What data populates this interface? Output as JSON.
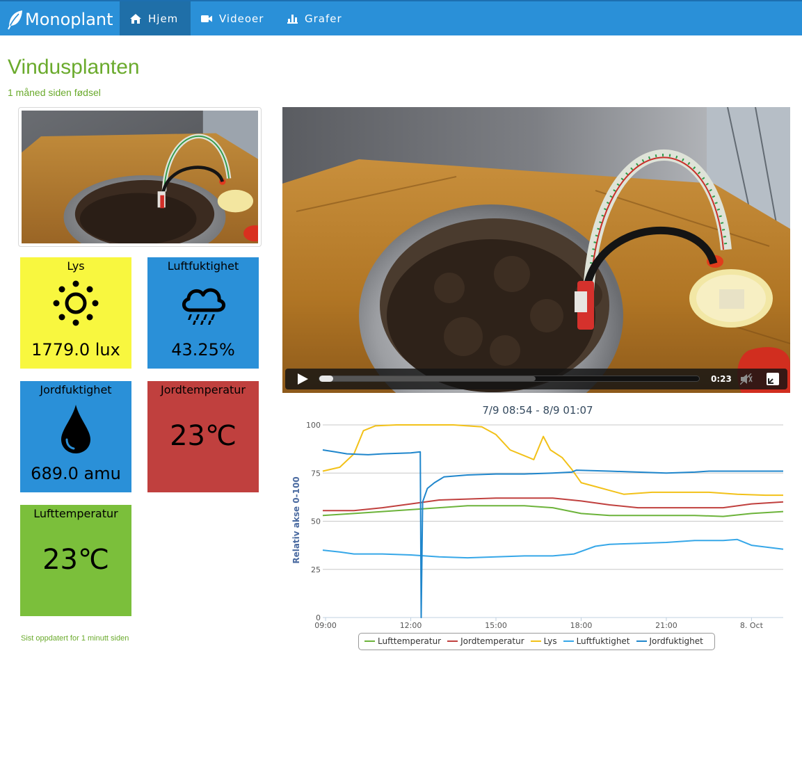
{
  "brand": {
    "name": "Monoplant"
  },
  "nav": {
    "items": [
      {
        "label": "Hjem",
        "icon": "home-icon",
        "active": true
      },
      {
        "label": "Videoer",
        "icon": "video-camera-icon",
        "active": false
      },
      {
        "label": "Grafer",
        "icon": "bar-chart-icon",
        "active": false
      }
    ]
  },
  "plant": {
    "name": "Vindusplanten",
    "age": "1 måned siden fødsel"
  },
  "sensors": {
    "lys": {
      "label": "Lys",
      "value": "1779.0 lux",
      "icon": "sun-icon",
      "color": "#f8f73f"
    },
    "luftfuktighet": {
      "label": "Luftfuktighet",
      "value": "43.25%",
      "icon": "rain-cloud-icon",
      "color": "#2a90d8"
    },
    "jordfuktighet": {
      "label": "Jordfuktighet",
      "value": "689.0 amu",
      "icon": "water-drop-icon",
      "color": "#2a90d8"
    },
    "jordtemperatur": {
      "label": "Jordtemperatur",
      "value": "23℃",
      "color": "#c0403e"
    },
    "lufttemperatur": {
      "label": "Lufttemperatur",
      "value": "23℃",
      "color": "#7bbf3b"
    }
  },
  "updated": "Sist oppdatert for 1 minutt siden",
  "video": {
    "time": "0:23",
    "progress": 0.0,
    "buffered": 0.57
  },
  "chart_data": {
    "type": "line",
    "title": "7/9 08:54 - 8/9 01:07",
    "ylabel": "Relativ akse 0-100",
    "ylim": [
      0,
      100
    ],
    "yticks": [
      0,
      25,
      50,
      75,
      100
    ],
    "xlim": [
      "08:54",
      "01:07"
    ],
    "xticks": [
      "09:00",
      "12:00",
      "15:00",
      "18:00",
      "21:00",
      "8. Oct"
    ],
    "grid": true,
    "legend": "bottom",
    "series": [
      {
        "name": "Lufttemperatur",
        "color": "#6cb33a",
        "points": [
          [
            "08:54",
            53
          ],
          [
            "10:00",
            54
          ],
          [
            "11:00",
            55
          ],
          [
            "12:00",
            56
          ],
          [
            "13:00",
            57
          ],
          [
            "14:00",
            58
          ],
          [
            "15:00",
            58
          ],
          [
            "16:00",
            58
          ],
          [
            "17:00",
            57
          ],
          [
            "18:00",
            54
          ],
          [
            "19:00",
            53
          ],
          [
            "20:00",
            53
          ],
          [
            "21:00",
            53
          ],
          [
            "22:00",
            53
          ],
          [
            "23:00",
            52.5
          ],
          [
            "00:00",
            54
          ],
          [
            "01:07",
            55
          ]
        ]
      },
      {
        "name": "Jordtemperatur",
        "color": "#c0403e",
        "points": [
          [
            "08:54",
            55.5
          ],
          [
            "10:00",
            55.5
          ],
          [
            "11:00",
            57
          ],
          [
            "12:00",
            59
          ],
          [
            "13:00",
            61
          ],
          [
            "14:00",
            61.5
          ],
          [
            "15:00",
            62
          ],
          [
            "16:00",
            62
          ],
          [
            "17:00",
            62
          ],
          [
            "18:00",
            60.5
          ],
          [
            "19:00",
            58.5
          ],
          [
            "20:00",
            57
          ],
          [
            "21:00",
            57
          ],
          [
            "22:00",
            57
          ],
          [
            "23:00",
            57
          ],
          [
            "00:00",
            59
          ],
          [
            "01:07",
            60
          ]
        ]
      },
      {
        "name": "Lys",
        "color": "#f2c118",
        "points": [
          [
            "08:54",
            76
          ],
          [
            "09:30",
            78
          ],
          [
            "10:00",
            85
          ],
          [
            "10:20",
            97
          ],
          [
            "10:45",
            99.5
          ],
          [
            "11:30",
            100
          ],
          [
            "12:30",
            100
          ],
          [
            "13:30",
            100
          ],
          [
            "14:30",
            99
          ],
          [
            "15:00",
            95
          ],
          [
            "15:30",
            87
          ],
          [
            "16:00",
            84
          ],
          [
            "16:20",
            82
          ],
          [
            "16:40",
            94
          ],
          [
            "16:55",
            87
          ],
          [
            "17:20",
            83
          ],
          [
            "17:40",
            77
          ],
          [
            "18:00",
            70
          ],
          [
            "18:30",
            68
          ],
          [
            "19:00",
            66
          ],
          [
            "19:30",
            64
          ],
          [
            "20:30",
            65
          ],
          [
            "21:30",
            65
          ],
          [
            "22:30",
            65
          ],
          [
            "23:30",
            64
          ],
          [
            "00:30",
            63.5
          ],
          [
            "01:07",
            63.5
          ]
        ]
      },
      {
        "name": "Luftfuktighet",
        "color": "#36a7e8",
        "points": [
          [
            "08:54",
            35
          ],
          [
            "09:30",
            34
          ],
          [
            "10:00",
            33
          ],
          [
            "11:00",
            33
          ],
          [
            "12:00",
            32.5
          ],
          [
            "12:30",
            32
          ],
          [
            "13:00",
            31.5
          ],
          [
            "14:00",
            31
          ],
          [
            "15:00",
            31.5
          ],
          [
            "16:00",
            32
          ],
          [
            "17:00",
            32
          ],
          [
            "17:45",
            33
          ],
          [
            "18:30",
            37
          ],
          [
            "19:00",
            38
          ],
          [
            "20:00",
            38.5
          ],
          [
            "21:00",
            39
          ],
          [
            "22:00",
            40
          ],
          [
            "23:00",
            40
          ],
          [
            "23:30",
            40.5
          ],
          [
            "00:00",
            37.5
          ],
          [
            "01:07",
            35.5
          ]
        ]
      },
      {
        "name": "Jordfuktighet",
        "color": "#1f86cc",
        "points": [
          [
            "08:54",
            87
          ],
          [
            "09:20",
            86
          ],
          [
            "09:45",
            85
          ],
          [
            "10:30",
            84.5
          ],
          [
            "11:00",
            85
          ],
          [
            "12:00",
            85.5
          ],
          [
            "12:20",
            86
          ],
          [
            "12:22",
            0
          ],
          [
            "12:25",
            60
          ],
          [
            "12:35",
            67
          ],
          [
            "12:50",
            70
          ],
          [
            "13:10",
            73
          ],
          [
            "14:00",
            74
          ],
          [
            "15:00",
            74.5
          ],
          [
            "16:00",
            74.5
          ],
          [
            "17:00",
            75
          ],
          [
            "17:40",
            75.5
          ],
          [
            "17:50",
            76.5
          ],
          [
            "19:00",
            76
          ],
          [
            "20:00",
            75.5
          ],
          [
            "21:00",
            75
          ],
          [
            "22:00",
            75.5
          ],
          [
            "22:30",
            76
          ],
          [
            "23:30",
            76
          ],
          [
            "00:30",
            76
          ],
          [
            "01:07",
            76
          ]
        ]
      }
    ]
  }
}
